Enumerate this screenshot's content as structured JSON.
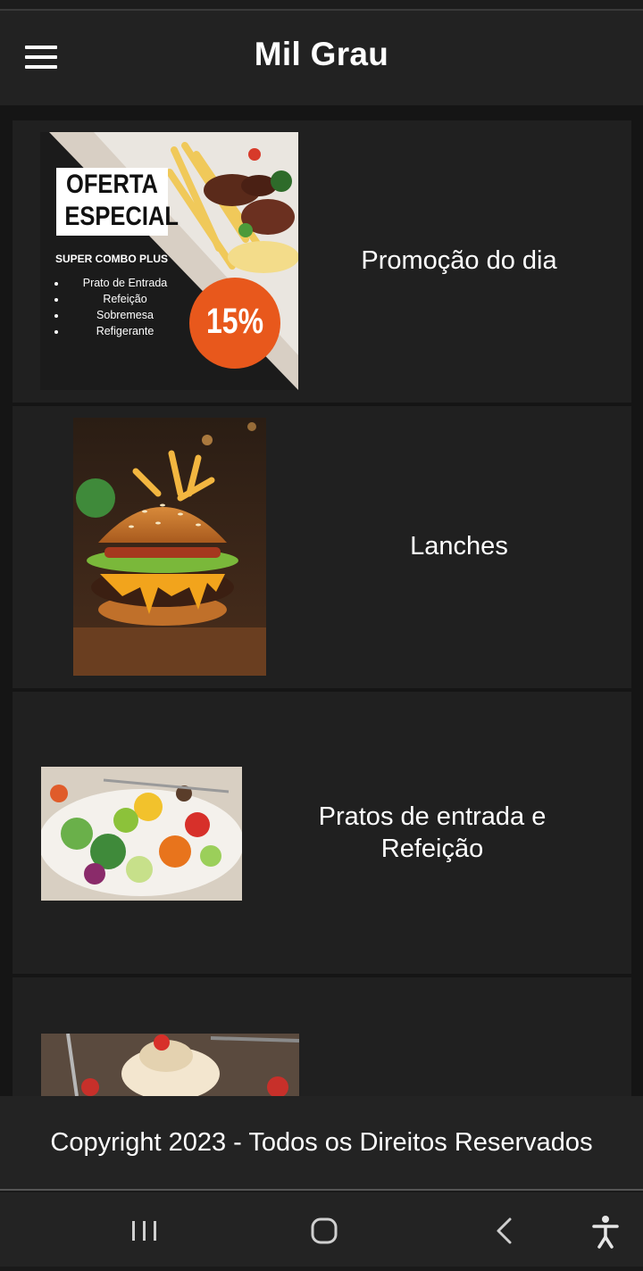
{
  "app": {
    "title": "Mil Grau"
  },
  "menu": {
    "label": "menu-icon"
  },
  "categories": [
    {
      "label": "Promoção do dia",
      "promo": {
        "heading_line1": "OFERTA",
        "heading_line2": "ESPECIAL",
        "subtitle": "SUPER COMBO PLUS",
        "items": [
          "Prato de Entrada",
          "Refeição",
          "Sobremesa",
          "Refigerante"
        ],
        "discount": "15%"
      }
    },
    {
      "label": "Lanches"
    },
    {
      "label": "Pratos de entrada e Refeição"
    },
    {
      "label": ""
    }
  ],
  "footer": {
    "copyright": "Copyright 2023 - Todos os Direitos Reservados"
  },
  "system_nav": {
    "recent_icon": "recent-apps-icon",
    "home_icon": "home-icon",
    "back_icon": "back-icon",
    "accessibility_icon": "accessibility-icon"
  },
  "colors": {
    "background": "#151515",
    "card": "#202020",
    "appbar": "#222222",
    "promo_orange": "#e8581c"
  }
}
